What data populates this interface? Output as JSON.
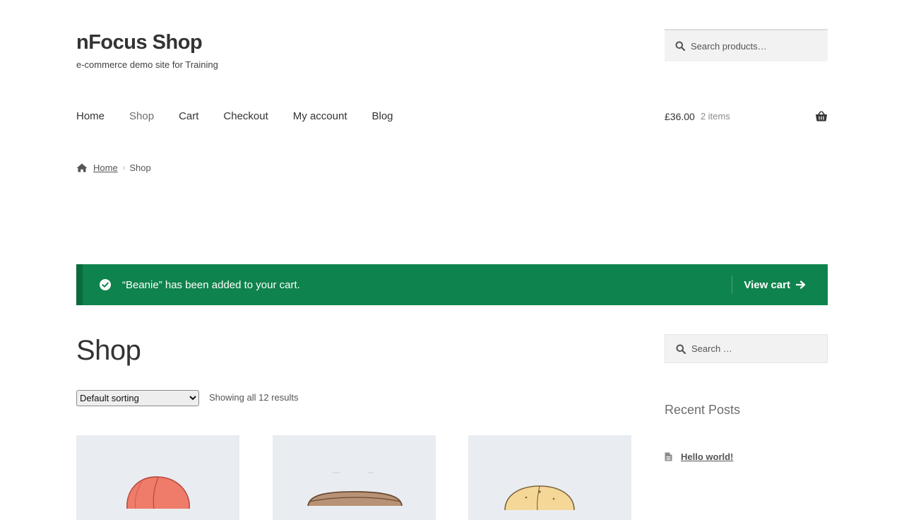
{
  "site": {
    "title": "nFocus Shop",
    "description": "e-commerce demo site for Training"
  },
  "header_search": {
    "placeholder": "Search products…",
    "icon": "search-icon"
  },
  "nav": {
    "items": [
      {
        "label": "Home"
      },
      {
        "label": "Shop",
        "current": true
      },
      {
        "label": "Cart"
      },
      {
        "label": "Checkout"
      },
      {
        "label": "My account"
      },
      {
        "label": "Blog"
      }
    ]
  },
  "cart": {
    "amount": "£36.00",
    "count": "2 items",
    "icon": "basket-icon"
  },
  "breadcrumb": {
    "icon": "home-icon",
    "home": "Home",
    "current": "Shop"
  },
  "notice": {
    "message": "“Beanie” has been added to your cart.",
    "action": "View cart",
    "color": "#0f834d",
    "icons": [
      "check-circle-icon",
      "arrow-right-icon"
    ]
  },
  "page": {
    "title": "Shop"
  },
  "sorting": {
    "selected": "Default sorting"
  },
  "results": {
    "text": "Showing all 12 results"
  },
  "products": [
    {
      "image": "red beanie"
    },
    {
      "image": "brown cap"
    },
    {
      "image": "yellow cap"
    }
  ],
  "sidebar": {
    "search_placeholder": "Search …",
    "recent_posts_title": "Recent Posts",
    "posts": [
      {
        "title": "Hello world!"
      }
    ]
  }
}
